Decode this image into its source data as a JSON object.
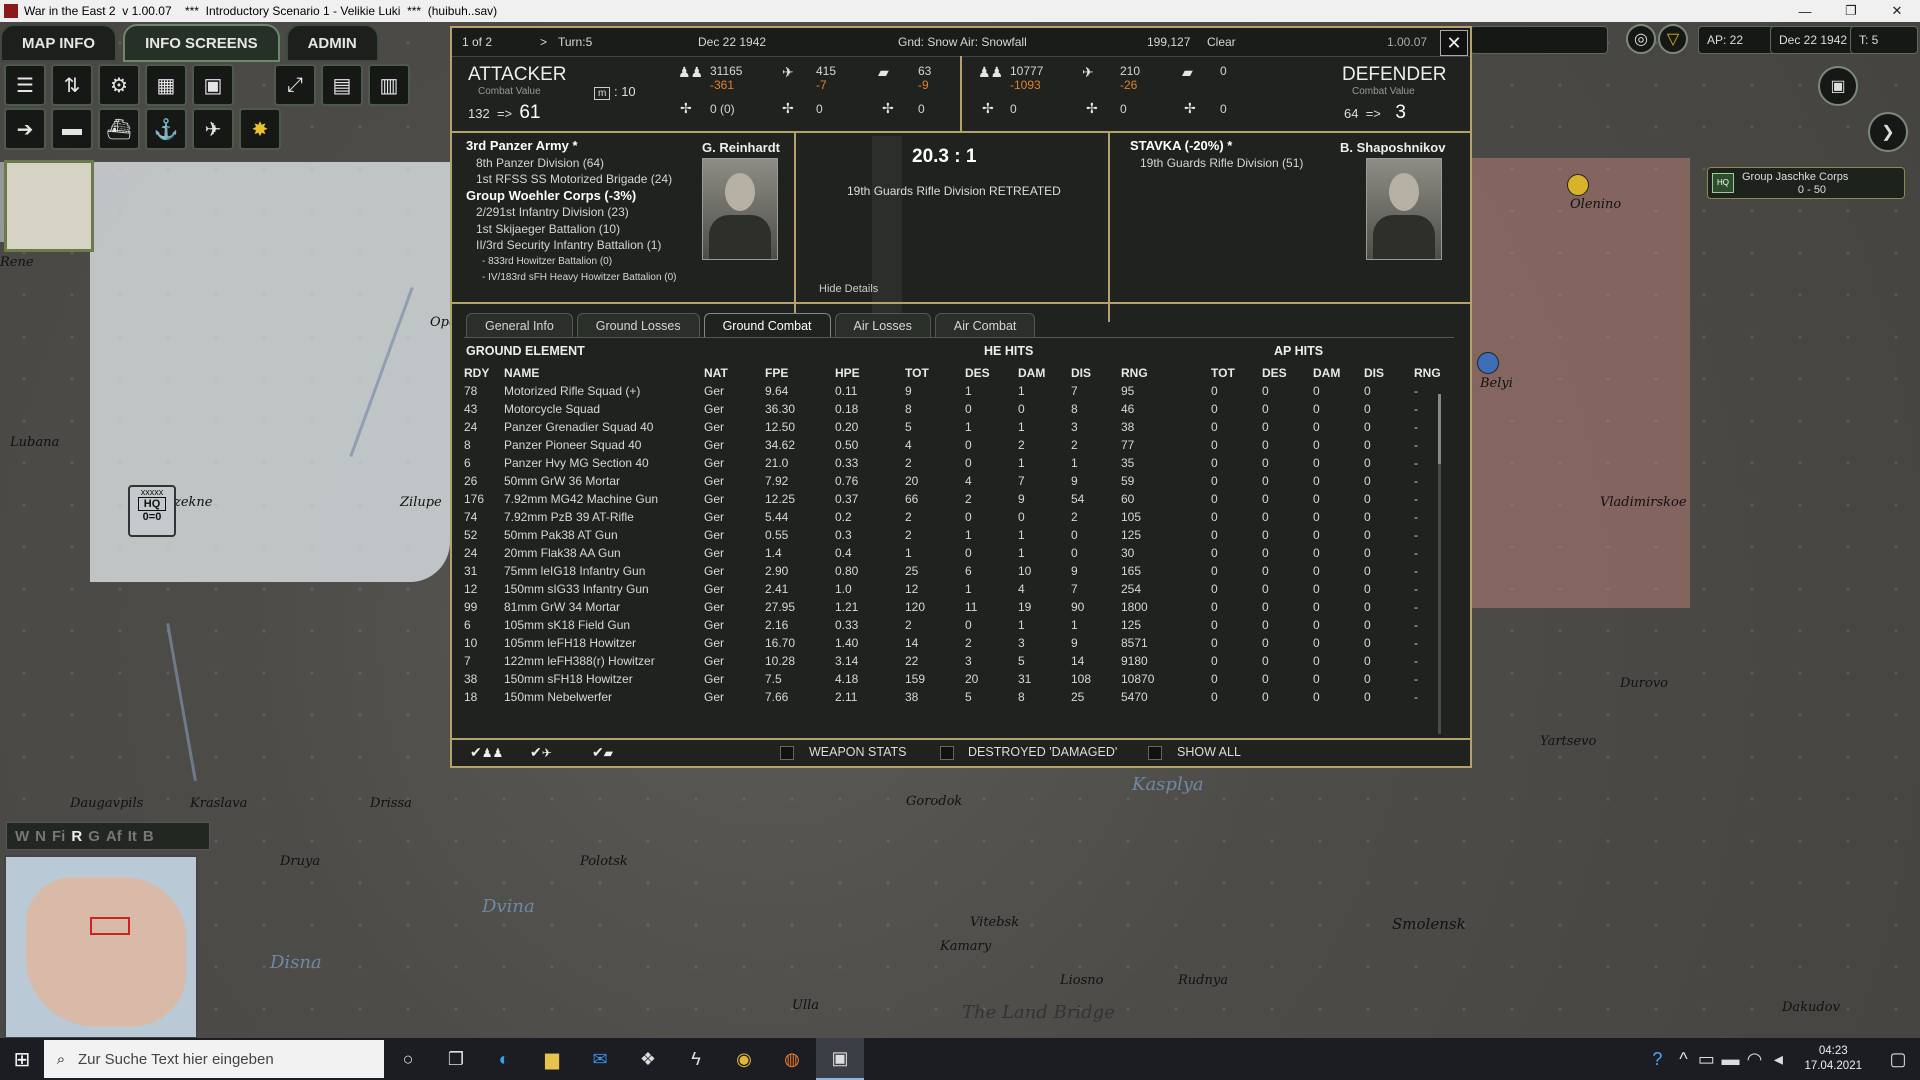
{
  "window": {
    "title": "War in the East 2  v 1.00.07    ***  Introductory Scenario 1 - Velikie Luki  ***  (huibuh..sav)",
    "min": "—",
    "max": "❐",
    "close": "✕"
  },
  "nav": {
    "tabs": [
      "MAP INFO",
      "INFO SCREENS",
      "ADMIN"
    ]
  },
  "topright": {
    "ap": "AP: 22",
    "date": "Dec 22 1942",
    "turn": "T: 5"
  },
  "map": {
    "labels": [
      "Olenino",
      "Belyi",
      "Vladimirskoe",
      "Durovo",
      "Yartsevo",
      "Kasplya",
      "Gorodok",
      "Vitebsk",
      "Kamary",
      "Liosno",
      "Rudnya",
      "Smolensk",
      "Dakudov",
      "Dvina",
      "Disna",
      "Drissa",
      "Kraslava",
      "Daugavpils",
      "Druya",
      "Polotsk",
      "Lubana",
      "Zilupe",
      "zekne",
      "Opochka",
      "Rene",
      "Ulla",
      "The Land Bridge"
    ],
    "hq_unit": {
      "label": "HQ",
      "size": "xxxxx",
      "strength": "0=0"
    },
    "corps_box": {
      "name": "Group Jaschke Corps",
      "range": "0 - 50",
      "badge": "HQ"
    },
    "filters": [
      "W",
      "N",
      "Fi",
      "R",
      "G",
      "Af",
      "It",
      "B"
    ]
  },
  "dialog": {
    "header": {
      "page": "1 of 2",
      "turn": "Turn:5",
      "date": "Dec 22 1942",
      "weather": "Gnd: Snow  Air: Snowfall",
      "coords": "199,127",
      "state": "Clear",
      "version": "1.00.07"
    },
    "attacker": {
      "title": "ATTACKER",
      "sub": "Combat Value",
      "cv_from": "132",
      "arrow": "=>",
      "cv_to": "61",
      "mod_icon": "m",
      "mod_value": ": 10",
      "men": "31165",
      "men_loss": "-361",
      "air": "415",
      "air_loss": "-7",
      "afv": "63",
      "afv_loss": "-9",
      "g1": "0 (0)",
      "g2": "0",
      "g3": "0",
      "units": [
        {
          "t": "3rd Panzer Army *",
          "c": "hd"
        },
        {
          "t": "8th Panzer Division (64)",
          "c": "i1"
        },
        {
          "t": "1st RFSS SS Motorized Brigade (24)",
          "c": "i1"
        },
        {
          "t": "Group Woehler Corps (-3%)",
          "c": "hd"
        },
        {
          "t": "2/291st Infantry Division (23)",
          "c": "i1"
        },
        {
          "t": "1st Skijaeger Battalion (10)",
          "c": "i1"
        },
        {
          "t": "II/3rd Security Infantry Battalion (1)",
          "c": "i1"
        },
        {
          "t": "- 833rd Howitzer Battalion (0)",
          "c": "i3"
        },
        {
          "t": "- IV/183rd sFH Heavy Howitzer Battalion (0)",
          "c": "i3"
        }
      ],
      "commander": "G. Reinhardt"
    },
    "defender": {
      "title": "DEFENDER",
      "sub": "Combat Value",
      "cv_from": "64",
      "arrow": "=>",
      "cv_to": "3",
      "men": "10777",
      "men_loss": "-1093",
      "air": "210",
      "air_loss": "-26",
      "afv": "0",
      "g1": "0",
      "g2": "0",
      "g3": "0",
      "units": [
        {
          "t": "STAVKA (-20%) *",
          "c": "hd"
        },
        {
          "t": "19th Guards Rifle Division (51)",
          "c": "i1"
        }
      ],
      "commander": "B. Shaposhnikov"
    },
    "ratio": "20.3 : 1",
    "result": "19th Guards Rifle Division RETREATED",
    "hide_details": "Hide Details",
    "tabs": [
      "General Info",
      "Ground Losses",
      "Ground Combat",
      "Air Losses",
      "Air Combat"
    ],
    "table": {
      "group_he": "HE HITS",
      "group_ap": "AP HITS",
      "element_title": "GROUND ELEMENT",
      "columns": [
        "RDY",
        "NAME",
        "NAT",
        "FPE",
        "HPE",
        "TOT",
        "DES",
        "DAM",
        "DIS",
        "RNG",
        "TOT",
        "DES",
        "DAM",
        "DIS",
        "RNG"
      ],
      "rows": [
        [
          "78",
          "Motorized Rifle Squad (+)",
          "Ger",
          "9.64",
          "0.11",
          "9",
          "1",
          "1",
          "7",
          "95",
          "0",
          "0",
          "0",
          "0",
          "-"
        ],
        [
          "43",
          "Motorcycle Squad",
          "Ger",
          "36.30",
          "0.18",
          "8",
          "0",
          "0",
          "8",
          "46",
          "0",
          "0",
          "0",
          "0",
          "-"
        ],
        [
          "24",
          "Panzer Grenadier Squad 40",
          "Ger",
          "12.50",
          "0.20",
          "5",
          "1",
          "1",
          "3",
          "38",
          "0",
          "0",
          "0",
          "0",
          "-"
        ],
        [
          "8",
          "Panzer Pioneer Squad 40",
          "Ger",
          "34.62",
          "0.50",
          "4",
          "0",
          "2",
          "2",
          "77",
          "0",
          "0",
          "0",
          "0",
          "-"
        ],
        [
          "6",
          "Panzer Hvy MG Section 40",
          "Ger",
          "21.0",
          "0.33",
          "2",
          "0",
          "1",
          "1",
          "35",
          "0",
          "0",
          "0",
          "0",
          "-"
        ],
        [
          "26",
          "50mm GrW 36 Mortar",
          "Ger",
          "7.92",
          "0.76",
          "20",
          "4",
          "7",
          "9",
          "59",
          "0",
          "0",
          "0",
          "0",
          "-"
        ],
        [
          "176",
          "7.92mm MG42 Machine Gun",
          "Ger",
          "12.25",
          "0.37",
          "66",
          "2",
          "9",
          "54",
          "60",
          "0",
          "0",
          "0",
          "0",
          "-"
        ],
        [
          "74",
          "7.92mm PzB 39 AT-Rifle",
          "Ger",
          "5.44",
          "0.2",
          "2",
          "0",
          "0",
          "2",
          "105",
          "0",
          "0",
          "0",
          "0",
          "-"
        ],
        [
          "52",
          "50mm Pak38 AT Gun",
          "Ger",
          "0.55",
          "0.3",
          "2",
          "1",
          "1",
          "0",
          "125",
          "0",
          "0",
          "0",
          "0",
          "-"
        ],
        [
          "24",
          "20mm Flak38 AA Gun",
          "Ger",
          "1.4",
          "0.4",
          "1",
          "0",
          "1",
          "0",
          "30",
          "0",
          "0",
          "0",
          "0",
          "-"
        ],
        [
          "31",
          "75mm leIG18 Infantry Gun",
          "Ger",
          "2.90",
          "0.80",
          "25",
          "6",
          "10",
          "9",
          "165",
          "0",
          "0",
          "0",
          "0",
          "-"
        ],
        [
          "12",
          "150mm sIG33 Infantry Gun",
          "Ger",
          "2.41",
          "1.0",
          "12",
          "1",
          "4",
          "7",
          "254",
          "0",
          "0",
          "0",
          "0",
          "-"
        ],
        [
          "99",
          "81mm GrW 34 Mortar",
          "Ger",
          "27.95",
          "1.21",
          "120",
          "11",
          "19",
          "90",
          "1800",
          "0",
          "0",
          "0",
          "0",
          "-"
        ],
        [
          "6",
          "105mm sK18 Field Gun",
          "Ger",
          "2.16",
          "0.33",
          "2",
          "0",
          "1",
          "1",
          "125",
          "0",
          "0",
          "0",
          "0",
          "-"
        ],
        [
          "10",
          "105mm leFH18 Howitzer",
          "Ger",
          "16.70",
          "1.40",
          "14",
          "2",
          "3",
          "9",
          "8571",
          "0",
          "0",
          "0",
          "0",
          "-"
        ],
        [
          "7",
          "122mm leFH388(r) Howitzer",
          "Ger",
          "10.28",
          "3.14",
          "22",
          "3",
          "5",
          "14",
          "9180",
          "0",
          "0",
          "0",
          "0",
          "-"
        ],
        [
          "38",
          "150mm sFH18 Howitzer",
          "Ger",
          "7.5",
          "4.18",
          "159",
          "20",
          "31",
          "108",
          "10870",
          "0",
          "0",
          "0",
          "0",
          "-"
        ],
        [
          "18",
          "150mm Nebelwerfer",
          "Ger",
          "7.66",
          "2.11",
          "38",
          "5",
          "8",
          "25",
          "5470",
          "0",
          "0",
          "0",
          "0",
          "-"
        ]
      ]
    },
    "footer": {
      "weapon_stats": "WEAPON STATS",
      "destroyed_damaged": "DESTROYED 'DAMAGED'",
      "show_all": "SHOW ALL"
    }
  },
  "taskbar": {
    "search_placeholder": "Zur Suche Text hier eingeben",
    "time": "04:23",
    "date": "17.04.2021"
  }
}
